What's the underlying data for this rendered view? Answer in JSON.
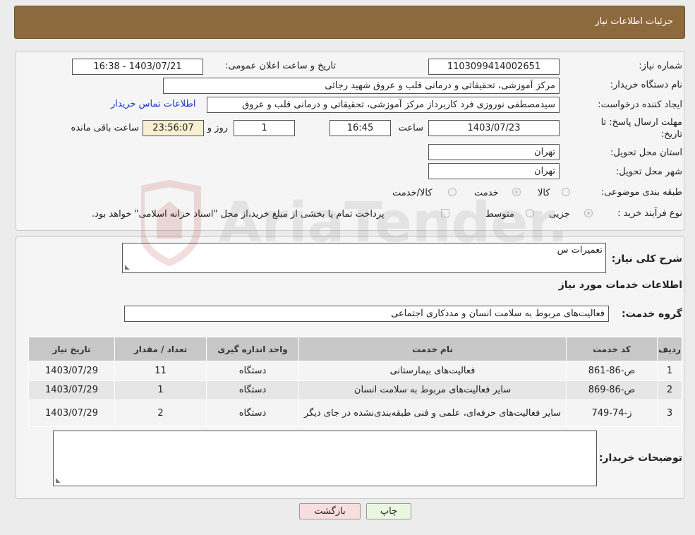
{
  "header": {
    "title": "جزئیات اطلاعات نیاز"
  },
  "form": {
    "need_number_label": "شماره نیاز:",
    "need_number": "1103099414002651",
    "announce_label": "تاریخ و ساعت اعلان عمومی:",
    "announce_value": "1403/07/21 - 16:38",
    "buyer_org_label": "نام دستگاه خریدار:",
    "buyer_org": "مرکز آموزشی، تحقیقاتی و درمانی قلب و عروق شهید رجائی",
    "creator_label": "ایجاد کننده درخواست:",
    "creator": "سیدمصطفی نوروزی فرد کاربرداز مرکز آموزشی، تحقیقاتی و درمانی قلب و عروق",
    "contact_link": "اطلاعات تماس خریدار",
    "deadline_label_1": "مهلت ارسال پاسخ: تا",
    "deadline_label_2": "تاریخ:",
    "deadline_date": "1403/07/23",
    "hour_label": "ساعت",
    "deadline_time": "16:45",
    "days_value": "1",
    "days_label": "روز و",
    "remaining_time": "23:56:07",
    "remaining_label": "ساعت باقی مانده",
    "province_label": "استان محل تحویل:",
    "province": "تهران",
    "city_label": "شهر محل تحویل:",
    "city": "تهران",
    "category_label": "طبقه بندی موضوعی:",
    "category_options": [
      "کالا",
      "خدمت",
      "کالا/خدمت"
    ],
    "category_selected": "خدمت",
    "purchase_label": "نوع فرآیند خرید :",
    "purchase_options": [
      "جزیی",
      "متوسط"
    ],
    "payment_note": "پرداخت تمام یا بخشی از مبلغ خرید،از محل \"اسناد خزانه اسلامی\" خواهد بود."
  },
  "details": {
    "summary_label": "شرح کلی نیاز:",
    "summary_value": "تعمیرات س",
    "services_heading": "اطلاعات خدمات مورد نیاز",
    "group_label": "گروه خدمت:",
    "group_value": "فعالیت‌های مربوط به سلامت انسان و مددکاری اجتماعی",
    "table": {
      "headers": [
        "ردیف",
        "کد خدمت",
        "نام خدمت",
        "واحد اندازه گیری",
        "تعداد / مقدار",
        "تاریخ نیاز"
      ],
      "rows": [
        [
          "1",
          "ص-86-861",
          "فعالیت‌های بیمارستانی",
          "دستگاه",
          "11",
          "1403/07/29"
        ],
        [
          "2",
          "ص-86-869",
          "سایر فعالیت‌های مربوط به سلامت انسان",
          "دستگاه",
          "1",
          "1403/07/29"
        ],
        [
          "3",
          "ز-74-749",
          "سایر فعالیت‌های حرفه‌ای، علمی و فنی طبقه‌بندی‌نشده در جای دیگر",
          "دستگاه",
          "2",
          "1403/07/29"
        ]
      ]
    },
    "buyer_notes_label": "توضیحات خریدار:",
    "buyer_notes_value": ""
  },
  "buttons": {
    "print": "چاپ",
    "back": "بازگشت",
    "print_color": "#eaf7e0",
    "back_color": "#f9dede"
  },
  "watermark": {
    "text": "AriaTender.neT"
  }
}
